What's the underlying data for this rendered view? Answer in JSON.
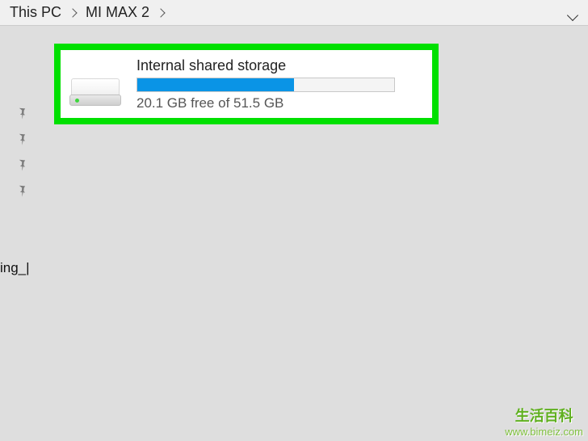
{
  "breadcrumb": {
    "items": [
      {
        "label": "This PC"
      },
      {
        "label": "MI MAX 2"
      }
    ]
  },
  "sidebar": {
    "pin_count": 4,
    "partial_label": "ing_|"
  },
  "storage": {
    "title": "Internal shared storage",
    "free_gb": 20.1,
    "total_gb": 51.5,
    "subtext": "20.1 GB free of 51.5 GB",
    "used_percent": 61
  },
  "watermark": {
    "title": "生活百科",
    "url": "www.bimeiz.com"
  }
}
